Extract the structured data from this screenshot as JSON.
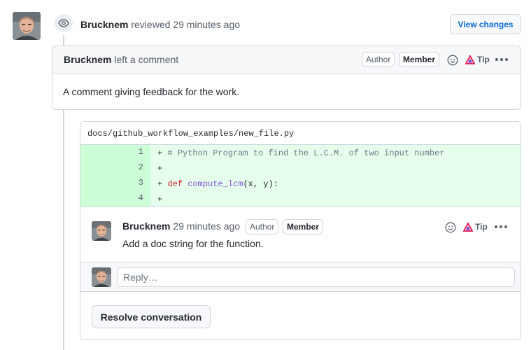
{
  "review": {
    "author": "Brucknem",
    "action": "reviewed",
    "time": "29 minutes ago",
    "view_changes_label": "View changes"
  },
  "top_comment": {
    "author": "Brucknem",
    "action": "left a comment",
    "author_label": "Author",
    "member_label": "Member",
    "tip_label": "Tip",
    "body": "A comment giving feedback for the work."
  },
  "file": {
    "path": "docs/github_workflow_examples/new_file.py",
    "lines": [
      {
        "num": "1",
        "prefix": "+ ",
        "comment": "# Python Program to find the L.C.M. of two input number"
      },
      {
        "num": "2",
        "prefix": "+",
        "comment": ""
      },
      {
        "num": "3",
        "prefix": "+ ",
        "keyword": "def",
        "function": "compute_lcm",
        "rest": "(x, y):"
      },
      {
        "num": "4",
        "prefix": "+",
        "comment": ""
      }
    ]
  },
  "inline_comment": {
    "author": "Brucknem",
    "time": "29 minutes ago",
    "author_label": "Author",
    "member_label": "Member",
    "tip_label": "Tip",
    "body": "Add a doc string for the function."
  },
  "reply": {
    "placeholder": "Reply…"
  },
  "resolve_label": "Resolve conversation",
  "colors": {
    "diff_add_bg": "#e6ffec",
    "diff_add_num_bg": "#ccffd8",
    "link_blue": "#0969da",
    "border": "#d0d7de"
  }
}
